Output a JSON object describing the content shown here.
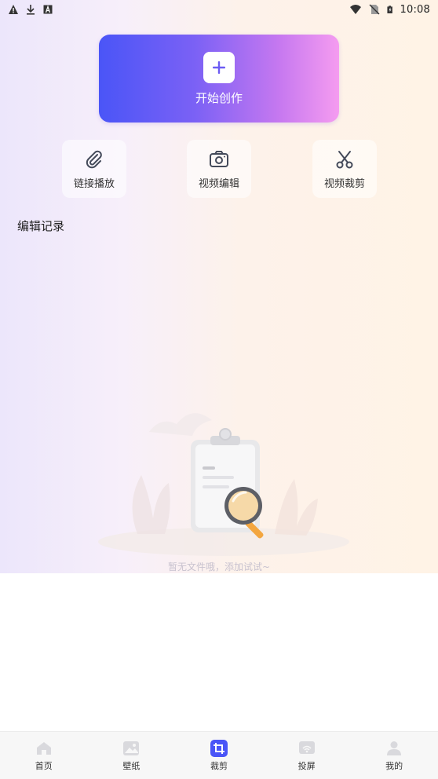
{
  "status_bar": {
    "time": "10:08",
    "left_icons": [
      "warning-icon",
      "download-icon",
      "a-box-icon"
    ],
    "right_icons": [
      "wifi-icon",
      "no-sim-icon",
      "battery-icon"
    ]
  },
  "create_button": {
    "label": "开始创作",
    "icon": "plus-icon",
    "gradient": [
      "#4a55f7",
      "#f59cf0"
    ]
  },
  "tools": [
    {
      "label": "链接播放",
      "icon": "paperclip-icon"
    },
    {
      "label": "视频编辑",
      "icon": "camera-icon"
    },
    {
      "label": "视频裁剪",
      "icon": "scissors-icon"
    }
  ],
  "section_title": "编辑记录",
  "empty_state": {
    "text": "暂无文件哦，添加试试~",
    "illustration": "clipboard-magnifier-illustration"
  },
  "tab_bar": {
    "active_color": "#4a55f7",
    "tabs": [
      {
        "label": "首页",
        "icon": "home-icon",
        "active": false
      },
      {
        "label": "壁纸",
        "icon": "image-icon",
        "active": false
      },
      {
        "label": "裁剪",
        "icon": "crop-icon",
        "active": true
      },
      {
        "label": "投屏",
        "icon": "cast-icon",
        "active": false
      },
      {
        "label": "我的",
        "icon": "user-icon",
        "active": false
      }
    ]
  }
}
